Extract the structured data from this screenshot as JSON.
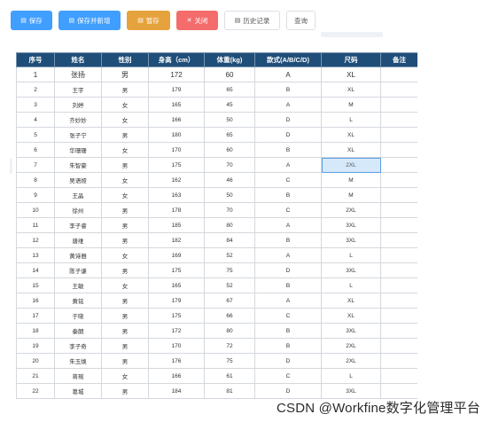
{
  "toolbar": {
    "save": {
      "icon": "document-icon",
      "label": "保存"
    },
    "save_new": {
      "icon": "document-icon",
      "label": "保存并新增"
    },
    "draft": {
      "icon": "document-icon",
      "label": "暂存"
    },
    "close": {
      "icon": "close-icon",
      "label": "关闭"
    },
    "history": {
      "icon": "document-icon",
      "label": "历史记录"
    },
    "query": {
      "label": "查询"
    }
  },
  "colors": {
    "primary": "#409eff",
    "warning": "#e6a23c",
    "danger": "#f56c6c",
    "header": "#1f4e79"
  },
  "table": {
    "columns": [
      "序号",
      "姓名",
      "性别",
      "身高（cm）",
      "体重(kg)",
      "款式(A/B/C/D)",
      "尺码",
      "备注"
    ],
    "selected": {
      "row": 7,
      "column": "尺码"
    },
    "rows": [
      [
        "1",
        "张扬",
        "男",
        "172",
        "60",
        "A",
        "XL",
        ""
      ],
      [
        "2",
        "王宇",
        "男",
        "179",
        "65",
        "B",
        "XL",
        ""
      ],
      [
        "3",
        "刘婷",
        "女",
        "165",
        "45",
        "A",
        "M",
        ""
      ],
      [
        "4",
        "齐妙妙",
        "女",
        "166",
        "50",
        "D",
        "L",
        ""
      ],
      [
        "5",
        "张子宁",
        "男",
        "180",
        "65",
        "D",
        "XL",
        ""
      ],
      [
        "6",
        "华珊珊",
        "女",
        "170",
        "60",
        "B",
        "XL",
        ""
      ],
      [
        "7",
        "朱智豪",
        "男",
        "175",
        "70",
        "A",
        "2XL",
        ""
      ],
      [
        "8",
        "吴语娅",
        "女",
        "162",
        "46",
        "C",
        "M",
        ""
      ],
      [
        "9",
        "王晶",
        "女",
        "163",
        "50",
        "B",
        "M",
        ""
      ],
      [
        "10",
        "徐州",
        "男",
        "178",
        "70",
        "C",
        "2XL",
        ""
      ],
      [
        "11",
        "李子睿",
        "男",
        "185",
        "80",
        "A",
        "3XL",
        ""
      ],
      [
        "12",
        "唐维",
        "男",
        "182",
        "84",
        "B",
        "3XL",
        ""
      ],
      [
        "13",
        "黄诗雅",
        "女",
        "169",
        "52",
        "A",
        "L",
        ""
      ],
      [
        "14",
        "陈子谦",
        "男",
        "175",
        "75",
        "D",
        "3XL",
        ""
      ],
      [
        "15",
        "王敏",
        "女",
        "165",
        "52",
        "B",
        "L",
        ""
      ],
      [
        "16",
        "黄铭",
        "男",
        "179",
        "67",
        "A",
        "XL",
        ""
      ],
      [
        "17",
        "于晓",
        "男",
        "175",
        "66",
        "C",
        "XL",
        ""
      ],
      [
        "18",
        "秦朗",
        "男",
        "172",
        "80",
        "B",
        "3XL",
        ""
      ],
      [
        "19",
        "李子奇",
        "男",
        "170",
        "72",
        "B",
        "2XL",
        ""
      ],
      [
        "20",
        "朱玉焕",
        "男",
        "176",
        "75",
        "D",
        "2XL",
        ""
      ],
      [
        "21",
        "蒋琬",
        "女",
        "166",
        "61",
        "C",
        "L",
        ""
      ],
      [
        "22",
        "葛城",
        "男",
        "184",
        "81",
        "D",
        "3XL",
        ""
      ]
    ]
  },
  "watermark": "CSDN @Workfine数字化管理平台"
}
